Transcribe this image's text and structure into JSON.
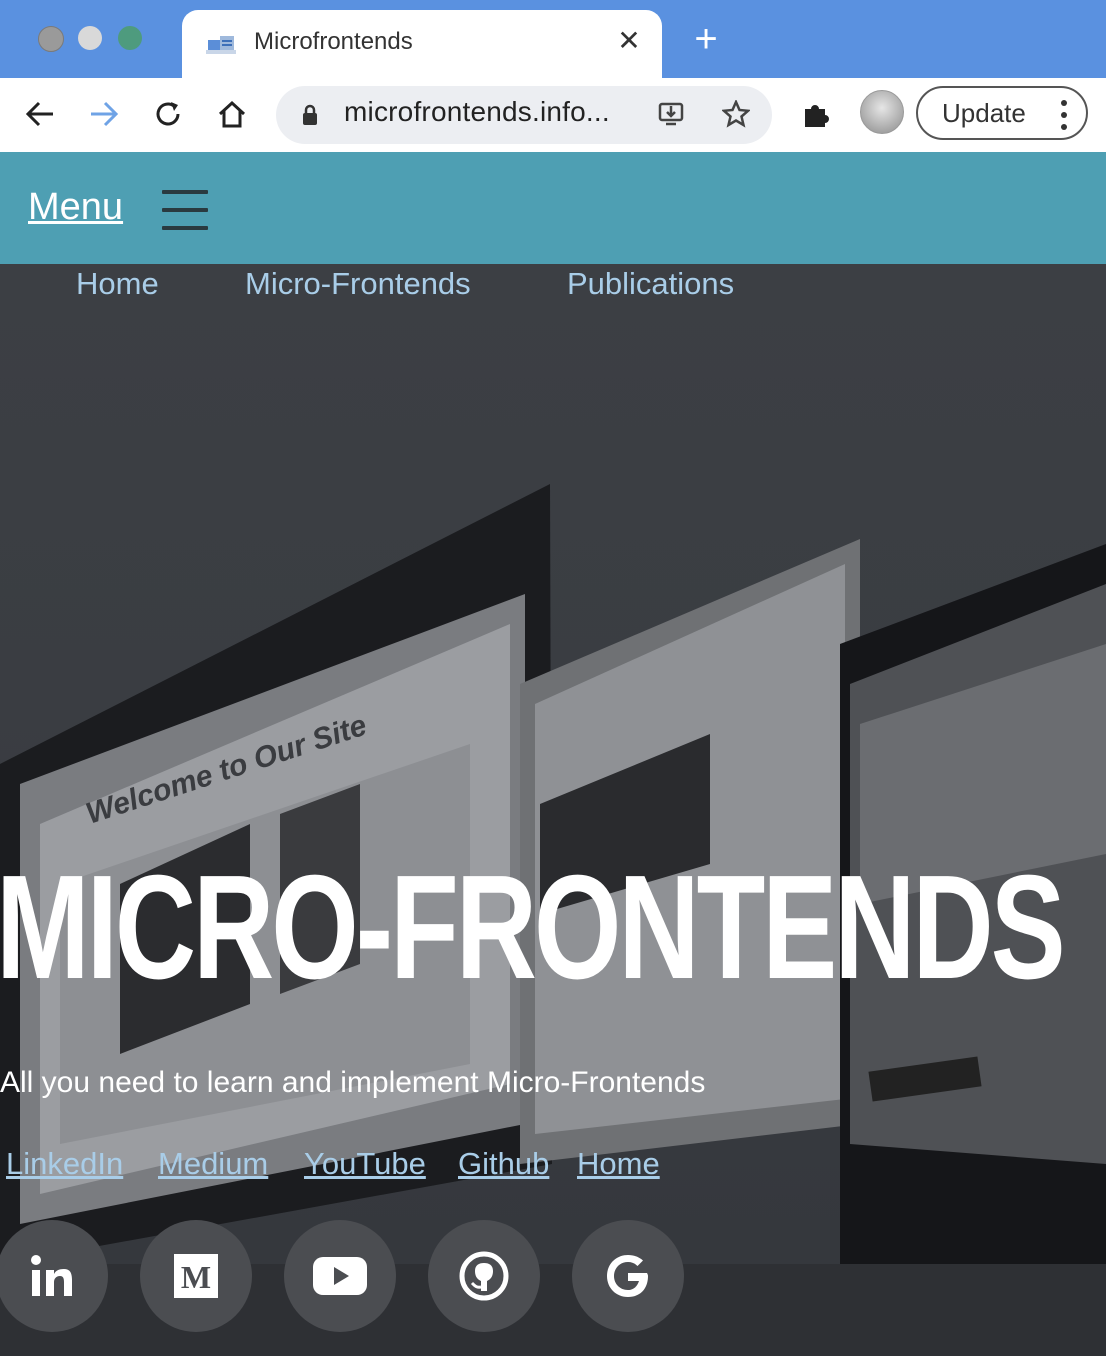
{
  "browser": {
    "tab_title": "Microfrontends",
    "tab_close_icon": "close-icon",
    "new_tab_icon": "plus-icon",
    "url": "microfrontends.info...",
    "update_label": "Update",
    "colors": {
      "titlebar": "#5a91e0",
      "toolbar": "#ffffff"
    }
  },
  "site": {
    "menu_label": "Menu",
    "header_color": "#4e9fb3",
    "nav": [
      {
        "label": "Home"
      },
      {
        "label": "Micro-Frontends"
      },
      {
        "label": "Publications"
      }
    ],
    "hero": {
      "title": "MICRO-FRONTENDS",
      "subtitle": "All you need to learn and implement Micro-Frontends"
    },
    "links": [
      {
        "label": "LinkedIn"
      },
      {
        "label": "Medium"
      },
      {
        "label": "YouTube"
      },
      {
        "label": "Github"
      },
      {
        "label": "Home"
      }
    ],
    "social_icons": [
      "linkedin-icon",
      "medium-icon",
      "youtube-icon",
      "github-icon",
      "google-icon"
    ],
    "link_color": "#a9cde8"
  }
}
